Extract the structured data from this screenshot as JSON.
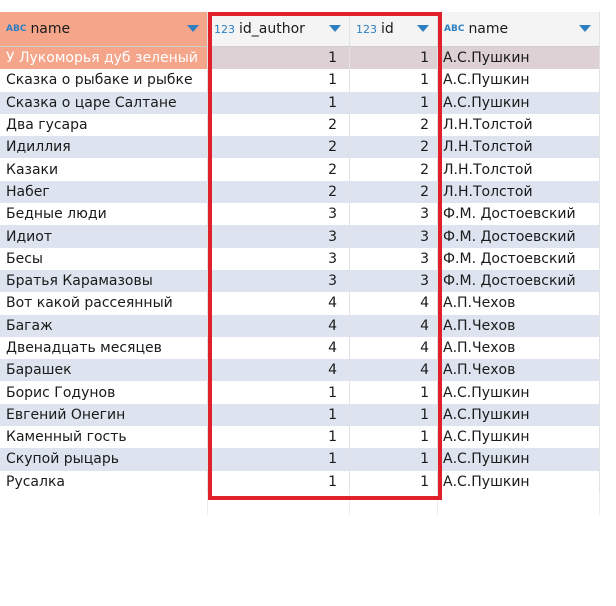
{
  "columns": [
    {
      "type_icon": "ABC",
      "label": "name"
    },
    {
      "type_icon": "123",
      "label": "id_author"
    },
    {
      "type_icon": "123",
      "label": "id"
    },
    {
      "type_icon": "ABC",
      "label": "name"
    }
  ],
  "rows": [
    {
      "title": "У Лукоморья дуб зеленый",
      "id_author": "1",
      "id": "1",
      "author": "А.С.Пушкин"
    },
    {
      "title": "Сказка о рыбаке и рыбке",
      "id_author": "1",
      "id": "1",
      "author": "А.С.Пушкин"
    },
    {
      "title": "Сказка о царе Салтане",
      "id_author": "1",
      "id": "1",
      "author": "А.С.Пушкин"
    },
    {
      "title": "Два гусара",
      "id_author": "2",
      "id": "2",
      "author": "Л.Н.Толстой"
    },
    {
      "title": "Идиллия",
      "id_author": "2",
      "id": "2",
      "author": "Л.Н.Толстой"
    },
    {
      "title": "Казаки",
      "id_author": "2",
      "id": "2",
      "author": "Л.Н.Толстой"
    },
    {
      "title": "Набег",
      "id_author": "2",
      "id": "2",
      "author": "Л.Н.Толстой"
    },
    {
      "title": "Бедные люди",
      "id_author": "3",
      "id": "3",
      "author": "Ф.М. Достоевский"
    },
    {
      "title": "Идиот",
      "id_author": "3",
      "id": "3",
      "author": "Ф.М. Достоевский"
    },
    {
      "title": "Бесы",
      "id_author": "3",
      "id": "3",
      "author": "Ф.М. Достоевский"
    },
    {
      "title": "Братья Карамазовы",
      "id_author": "3",
      "id": "3",
      "author": "Ф.М. Достоевский"
    },
    {
      "title": "Вот какой рассеянный",
      "id_author": "4",
      "id": "4",
      "author": "А.П.Чехов"
    },
    {
      "title": "Багаж",
      "id_author": "4",
      "id": "4",
      "author": "А.П.Чехов"
    },
    {
      "title": "Двенадцать месяцев",
      "id_author": "4",
      "id": "4",
      "author": "А.П.Чехов"
    },
    {
      "title": "Барашек",
      "id_author": "4",
      "id": "4",
      "author": "А.П.Чехов"
    },
    {
      "title": "Борис Годунов",
      "id_author": "1",
      "id": "1",
      "author": "А.С.Пушкин"
    },
    {
      "title": "Евгений Онегин",
      "id_author": "1",
      "id": "1",
      "author": "А.С.Пушкин"
    },
    {
      "title": "Каменный гость",
      "id_author": "1",
      "id": "1",
      "author": "А.С.Пушкин"
    },
    {
      "title": "Скупой рыцарь",
      "id_author": "1",
      "id": "1",
      "author": "А.С.Пушкин"
    },
    {
      "title": "Русалка",
      "id_author": "1",
      "id": "1",
      "author": "А.С.Пушкин"
    }
  ],
  "colors": {
    "selected_header": "#f4a58a",
    "alt_row": "#dde4ef",
    "highlight_box": "#e0202a",
    "type_icon": "#2d7fc1"
  }
}
